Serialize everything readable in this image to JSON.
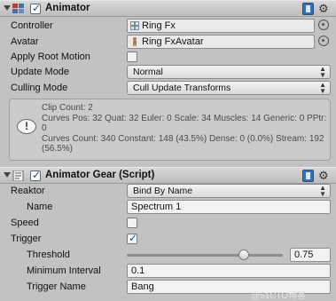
{
  "animator": {
    "title": "Animator",
    "enabled": true,
    "icons": {
      "fold": "fold-triangle-icon",
      "component": "animator-icon",
      "help": "help-book-icon",
      "settings": "gear-icon"
    },
    "controller": {
      "label": "Controller",
      "value": "Ring Fx",
      "icon": "animator-controller-icon"
    },
    "avatar": {
      "label": "Avatar",
      "value": "Ring FxAvatar",
      "icon": "avatar-icon"
    },
    "apply_root_motion": {
      "label": "Apply Root Motion",
      "checked": false
    },
    "update_mode": {
      "label": "Update Mode",
      "value": "Normal"
    },
    "culling_mode": {
      "label": "Culling Mode",
      "value": "Cull Update Transforms"
    },
    "info": {
      "line1": "Clip Count: 2",
      "line2": "Curves Pos: 32 Quat: 32 Euler: 0 Scale: 34 Muscles: 14 Generic: 0 PPtr: 0",
      "line3": "Curves Count: 340 Constant: 148 (43.5%) Dense: 0 (0.0%) Stream: 192 (56.5%)"
    }
  },
  "animator_gear": {
    "title": "Animator Gear (Script)",
    "enabled": true,
    "reaktor": {
      "label": "Reaktor",
      "value": "Bind By Name"
    },
    "name": {
      "label": "Name",
      "value": "Spectrum 1"
    },
    "speed": {
      "label": "Speed",
      "checked": false
    },
    "trigger": {
      "label": "Trigger",
      "checked": true
    },
    "threshold": {
      "label": "Threshold",
      "value": "0.75",
      "fraction": 0.75
    },
    "minimum_interval": {
      "label": "Minimum Interval",
      "value": "0.1"
    },
    "trigger_name": {
      "label": "Trigger Name",
      "value": "Bang"
    }
  },
  "watermark": "@51CTO博客"
}
